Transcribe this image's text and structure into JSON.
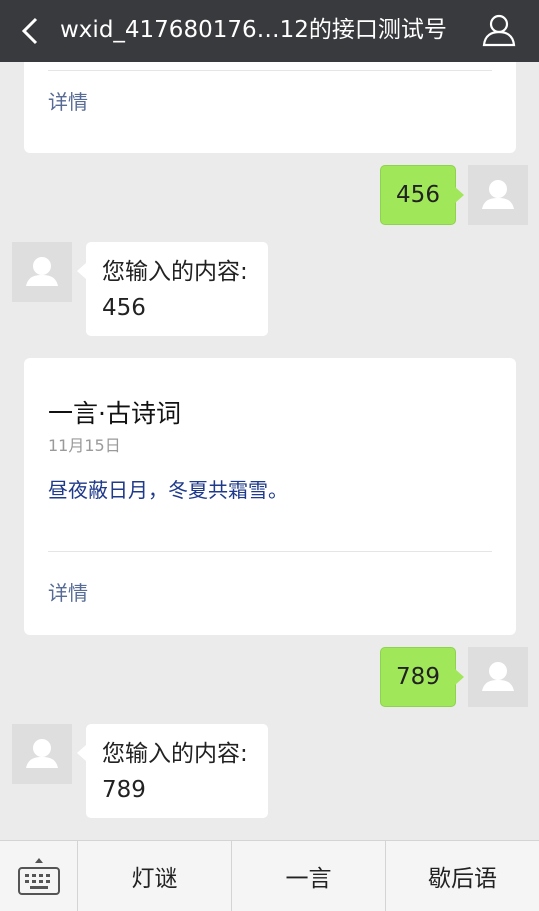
{
  "header": {
    "title": "wxid_417680176…12的接口测试号",
    "back_icon": "chevron-left-icon",
    "profile_icon": "person-icon"
  },
  "messages": {
    "card1": {
      "detail_label": "详情"
    },
    "sent1": {
      "text": "456"
    },
    "reply1": {
      "line1": "您输入的内容:",
      "line2": "456"
    },
    "card2": {
      "title": "一言·古诗词",
      "date": "11月15日",
      "body": "昼夜蔽日月，冬夏共霜雪。",
      "detail_label": "详情"
    },
    "sent2": {
      "text": "789"
    },
    "reply2": {
      "line1": "您输入的内容:",
      "line2": "789"
    }
  },
  "bottom_menu": {
    "keyboard_icon": "keyboard-icon",
    "items": [
      {
        "label": "灯谜"
      },
      {
        "label": "一言"
      },
      {
        "label": "歇后语"
      }
    ]
  },
  "colors": {
    "header_bg": "#393a3e",
    "sent_bubble": "#a0e75a",
    "link": "#576b95",
    "poem_text": "#1f3a8a"
  }
}
